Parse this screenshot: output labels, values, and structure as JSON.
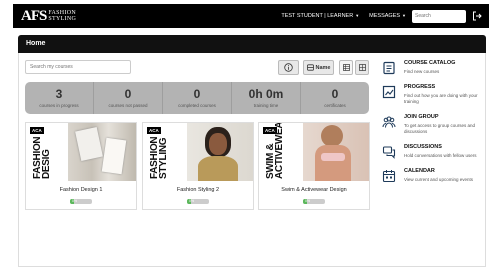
{
  "brand": {
    "mark": "AFS",
    "sub_line1": "FASHION",
    "sub_line2": "STYLING"
  },
  "topbar": {
    "user": "TEST STUDENT | LEARNER",
    "messages": "MESSAGES",
    "search_placeholder": "Search"
  },
  "page": {
    "title": "Home"
  },
  "toolbar": {
    "search_placeholder": "Search my courses",
    "sort_label": "Name"
  },
  "stats": [
    {
      "value": "3",
      "label": "courses in progress"
    },
    {
      "value": "0",
      "label": "courses not passed"
    },
    {
      "value": "0",
      "label": "completed courses"
    },
    {
      "value": "0h 0m",
      "label": "training time"
    },
    {
      "value": "0",
      "label": "certificates"
    }
  ],
  "courses": [
    {
      "badge": "ACA",
      "cover_text": "FASHION DESIG",
      "title": "Fashion Design 1",
      "progress_text": "0%",
      "progress": 0
    },
    {
      "badge": "ACA",
      "cover_text": "FASHION STYLING",
      "title": "Fashion Styling 2",
      "progress_text": "0%",
      "progress": 0
    },
    {
      "badge": "ACA",
      "cover_text": "SWIM & ACTIVEWEAR",
      "title": "Swim & Activewear Design",
      "progress_text": "0%",
      "progress": 0
    }
  ],
  "sidebar": [
    {
      "icon": "catalog-icon",
      "title": "COURSE CATALOG",
      "desc": "Find new courses"
    },
    {
      "icon": "progress-icon",
      "title": "PROGRESS",
      "desc": "Find out how you are doing with your training"
    },
    {
      "icon": "group-icon",
      "title": "JOIN GROUP",
      "desc": "To get access to group courses and discussions"
    },
    {
      "icon": "discussion-icon",
      "title": "DISCUSSIONS",
      "desc": "Hold conversations with fellow users"
    },
    {
      "icon": "calendar-icon",
      "title": "CALENDAR",
      "desc": "View current and upcoming events"
    }
  ],
  "colors": {
    "header_bg": "#000000",
    "stats_bg": "#b3b3b3",
    "progress_fill": "#5cb85c"
  }
}
